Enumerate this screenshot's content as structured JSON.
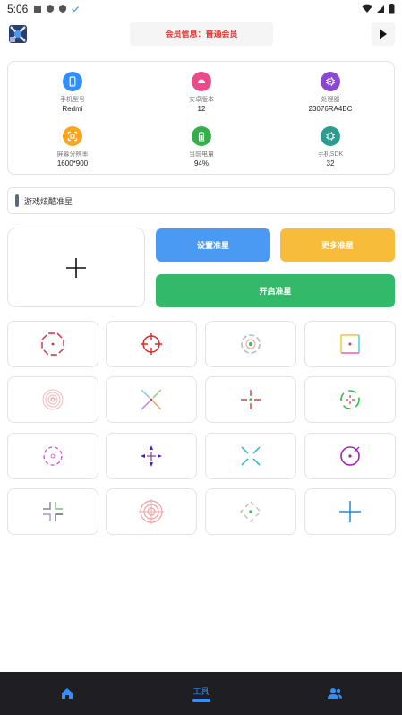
{
  "status_bar": {
    "time": "5:06"
  },
  "header": {
    "member_label": "会员信息：普通会员"
  },
  "device_info": [
    {
      "label": "手机型号",
      "value": "Redmi",
      "icon": "phone-icon",
      "color": "#2f8fff"
    },
    {
      "label": "安卓版本",
      "value": "12",
      "icon": "android-icon",
      "color": "#ea4c89"
    },
    {
      "label": "处理器",
      "value": "23076RA4BC",
      "icon": "cpu-icon",
      "color": "#8b47d4"
    },
    {
      "label": "屏幕分辨率",
      "value": "1600*900",
      "icon": "screen-icon",
      "color": "#f6a623"
    },
    {
      "label": "当前电量",
      "value": "94%",
      "icon": "battery-icon",
      "color": "#33b04a"
    },
    {
      "label": "手机SDK",
      "value": "32",
      "icon": "chip-icon",
      "color": "#2a9d8f"
    }
  ],
  "section": {
    "title": "游戏炫酷准星"
  },
  "buttons": {
    "set": "设置准星",
    "more": "更多准星",
    "open": "开启准星"
  },
  "crosshairs": [
    {
      "name": "crosshair-red-octagon",
      "color": "#d62c3a"
    },
    {
      "name": "crosshair-red-scope",
      "color": "#e52222"
    },
    {
      "name": "crosshair-gray-green-dot",
      "color": "#30c050"
    },
    {
      "name": "crosshair-rainbow-square",
      "color": "#f4c430"
    },
    {
      "name": "crosshair-pink-rings",
      "color": "#f08080"
    },
    {
      "name": "crosshair-multicolor-x",
      "color": "#7cc8f0"
    },
    {
      "name": "crosshair-red-cross-dot",
      "color": "#e53935"
    },
    {
      "name": "crosshair-green-bracket",
      "color": "#2bc43b"
    },
    {
      "name": "crosshair-magenta-dashed",
      "color": "#d946ef"
    },
    {
      "name": "crosshair-purple-diamond",
      "color": "#4b1cb5"
    },
    {
      "name": "crosshair-cyan-x",
      "color": "#18b8d0"
    },
    {
      "name": "crosshair-purple-circle",
      "color": "#9b27b0"
    },
    {
      "name": "crosshair-multicolor-corners",
      "color": "#888888"
    },
    {
      "name": "crosshair-pink-target",
      "color": "#f4a0a0"
    },
    {
      "name": "crosshair-gray-dashed-green",
      "color": "#2bc43b"
    },
    {
      "name": "crosshair-blue-plus",
      "color": "#1e88e5"
    }
  ],
  "bottom_nav": [
    {
      "name": "home",
      "label": "",
      "icon": "home-icon"
    },
    {
      "name": "tools",
      "label": "工具",
      "icon": ""
    },
    {
      "name": "users",
      "label": "",
      "icon": "users-icon"
    }
  ],
  "colors": {
    "accent": "#2f8fff",
    "nav_bg": "#1f1f23"
  }
}
